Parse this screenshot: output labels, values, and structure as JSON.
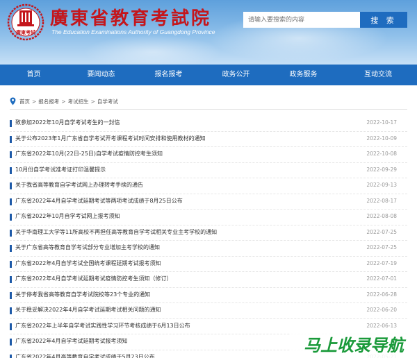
{
  "header": {
    "title": "廣東省教育考試院",
    "subtitle": "The Education Examinations Authority of Guangdong Province",
    "logo_text": "廣東考試"
  },
  "search": {
    "placeholder": "请输入要搜索的内容",
    "button_label": "搜 索"
  },
  "nav": [
    {
      "label": "首页"
    },
    {
      "label": "要闻动态"
    },
    {
      "label": "报名报考"
    },
    {
      "label": "政务公开"
    },
    {
      "label": "政务服务"
    },
    {
      "label": "互动交流"
    }
  ],
  "breadcrumb": [
    "首页",
    "报名报考",
    "考试招生",
    "自学考试"
  ],
  "breadcrumb_sep": ">",
  "articles": [
    {
      "title": "致参加2022年10月自学考试考生的一封信",
      "date": "2022-10-17"
    },
    {
      "title": "关于公布2023年1月广东省自学考试开考课程考试时间安排和使用教材的通知",
      "date": "2022-10-09"
    },
    {
      "title": "广东省2022年10月(22日-25日)自学考试疫情防控考生须知",
      "date": "2022-10-08"
    },
    {
      "title": "10月份自学考试准考证打印温馨提示",
      "date": "2022-09-29"
    },
    {
      "title": "关于我省高等教育自学考试网上办理转考手续的通告",
      "date": "2022-09-13"
    },
    {
      "title": "广东省2022年4月自学考试延期考试等两项考试成绩于8月25日公布",
      "date": "2022-08-17"
    },
    {
      "title": "广东省2022年10月自学考试网上报考须知",
      "date": "2022-08-08"
    },
    {
      "title": "关于华南理工大学等11所高校不再担任高等教育自学考试相关专业主考学校的通知",
      "date": "2022-07-25"
    },
    {
      "title": "关于广东省高等教育自学考试部分专业增加主考学校的通知",
      "date": "2022-07-25"
    },
    {
      "title": "广东省2022年4月自学考试全国统考课程延期考试报考须知",
      "date": "2022-07-19"
    },
    {
      "title": "广东省2022年4月自学考试延期考试疫情防控考生须知（修订）",
      "date": "2022-07-01"
    },
    {
      "title": "关于停考我省高等教育自学考试院校等23个专业的通知",
      "date": "2022-06-28"
    },
    {
      "title": "关于稳妥解决2022年4月自学考试延期考试相关问题的通知",
      "date": "2022-06-20"
    },
    {
      "title": "广东省2022年上半年自学考试实践性学习环节考核成绩于6月13日公布",
      "date": "2022-06-13"
    },
    {
      "title": "广东省2022年4月自学考试延期考试报考须知",
      "date": ""
    },
    {
      "title": "广东省2022年4月高等教育自学考试成绩于5月23日公布",
      "date": "2022-05-21"
    }
  ],
  "watermark": "马上收录导航",
  "colors": {
    "nav_bg": "#1e6cbf",
    "title_red": "#c4161c",
    "bullet": "#1e5aa8",
    "watermark": "#1a9a3a"
  }
}
